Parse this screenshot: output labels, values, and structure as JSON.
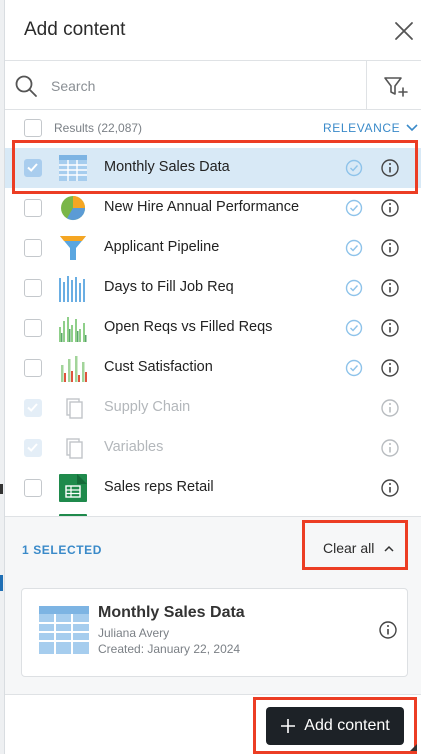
{
  "dialog": {
    "title": "Add content",
    "close_icon": "close-icon"
  },
  "search": {
    "placeholder": "Search",
    "value": "",
    "search_icon": "search-icon",
    "filter_icon": "filter-add-icon"
  },
  "results": {
    "count_label": "Results (22,087)",
    "sort_label": "RELEVANCE"
  },
  "items": [
    {
      "name": "Monthly Sales Data",
      "thumb": "table-icon",
      "checked": true,
      "selected": true,
      "certified": true
    },
    {
      "name": "New Hire Annual Performance",
      "thumb": "pie-chart-icon",
      "checked": false,
      "certified": true
    },
    {
      "name": "Applicant Pipeline",
      "thumb": "funnel-chart-icon",
      "checked": false,
      "certified": true
    },
    {
      "name": "Days to Fill Job Req",
      "thumb": "bar-chart-icon",
      "checked": false,
      "certified": true
    },
    {
      "name": "Open Reqs vs Filled Reqs",
      "thumb": "bar-chart-icon",
      "checked": false,
      "certified": true
    },
    {
      "name": "Cust Satisfaction",
      "thumb": "bar-chart-icon",
      "checked": false,
      "certified": true
    },
    {
      "name": "Supply Chain",
      "thumb": "copy-icon",
      "checked": true,
      "disabled": true,
      "certified": false
    },
    {
      "name": "Variables",
      "thumb": "copy-icon",
      "checked": true,
      "disabled": true,
      "certified": false
    },
    {
      "name": "Sales reps Retail",
      "thumb": "spreadsheet-icon",
      "checked": false,
      "certified": false
    }
  ],
  "selected": {
    "count_label": "1 SELECTED",
    "clear_label": "Clear all",
    "card": {
      "title": "Monthly Sales Data",
      "owner": "Juliana Avery",
      "created": "Created: January 22, 2024"
    }
  },
  "footer": {
    "add_label": "Add content"
  },
  "colors": {
    "accent": "#3a8ac9",
    "highlight": "#ec3d24",
    "selected_row": "#d8e9f6",
    "primary_button": "#1d2227"
  }
}
